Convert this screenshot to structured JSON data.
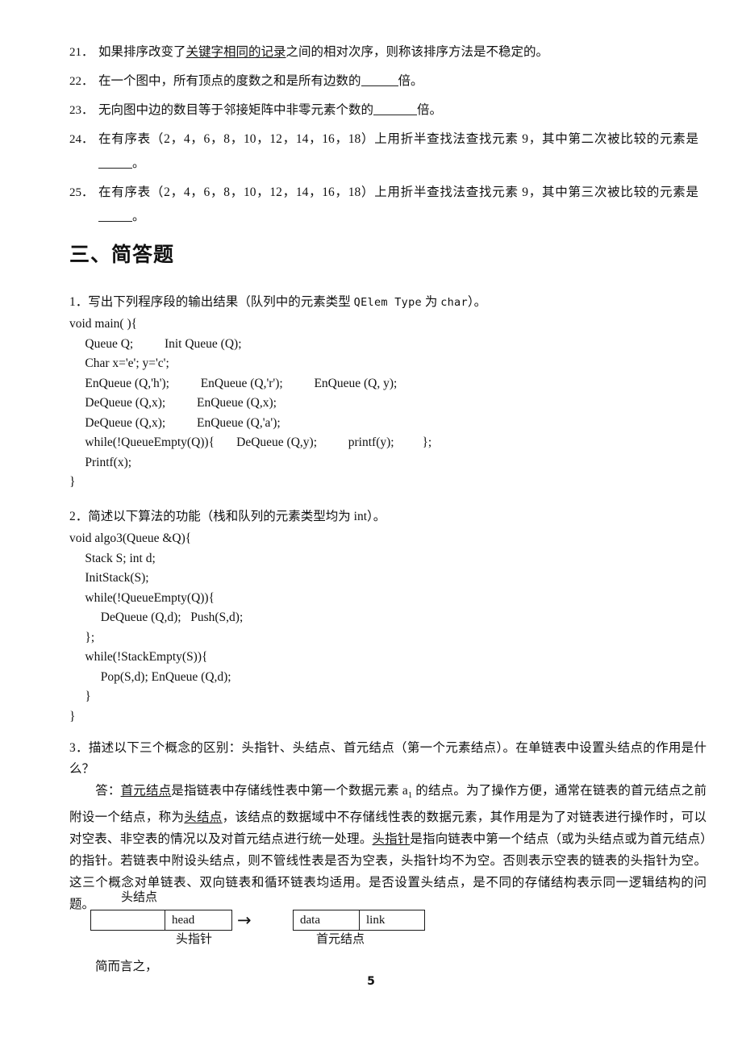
{
  "document": {
    "page_number": "5",
    "fill_in_questions": [
      {
        "number": "21．",
        "pre": "如果排序改变了",
        "underlined": "关键字相同的记录",
        "post": "之间的相对次序，则称该排序方法是不稳定的。",
        "has_blank": false
      },
      {
        "number": "22．",
        "pre": "在一个图中，所有顶点的度数之和是所有边数的",
        "underlined": "",
        "post": "倍。",
        "has_blank": true
      },
      {
        "number": "23．",
        "pre": "无向图中边的数目等于邻接矩阵中非零元素个数的",
        "underlined": "",
        "post": "倍。",
        "has_blank": true
      },
      {
        "number": "24．",
        "pre": "在有序表（2，4，6，8，10，12，14，16，18）上用折半查找法查找元素 9，其中第二次被比较的元素是",
        "underlined": "",
        "post": "。",
        "has_blank": true
      },
      {
        "number": "25．",
        "pre": "在有序表（2，4，6，8，10，12，14，16，18）上用折半查找法查找元素 9，其中第三次被比较的元素是",
        "underlined": "",
        "post": "。",
        "has_blank": true
      }
    ],
    "section_heading": "三、简答题",
    "short_answers": [
      {
        "number": "1．",
        "prompt_a": "写出下列程序段的输出结果（队列中的元素类型 ",
        "prompt_mono": "QElem Type",
        "prompt_b": " 为 ",
        "prompt_mono2": "char",
        "prompt_c": "）。",
        "code": "void main( ){\n     Queue Q;          Init Queue (Q);\n     Char x='e'; y='c';\n     EnQueue (Q,'h');          EnQueue (Q,'r');          EnQueue (Q, y);\n     DeQueue (Q,x);          EnQueue (Q,x);\n     DeQueue (Q,x);          EnQueue (Q,'a');\n     while(!QueueEmpty(Q)){       DeQueue (Q,y);          printf(y);         };\n     Printf(x);\n}"
      },
      {
        "number": "2．",
        "prompt_a": "简述以下算法的功能（栈和队列的元素类型均为 int）。",
        "code": "void algo3(Queue &Q){\n     Stack S; int d;\n     InitStack(S);\n     while(!QueueEmpty(Q)){\n          DeQueue (Q,d);   Push(S,d);\n     };\n     while(!StackEmpty(S)){\n          Pop(S,d); EnQueue (Q,d);\n     }\n}"
      }
    ],
    "question3": {
      "number": "3．",
      "prompt": "描述以下三个概念的区别：头指针、头结点、首元结点（第一个元素结点）。在单链表中设置头结点的作用是什么？",
      "answer_label": "答：",
      "answer_seg1_underline": "首元结点",
      "answer_seg2": "是指链表中存储线性表中第一个数据元素 a",
      "answer_sub": "1",
      "answer_seg3": " 的结点。为了操作方便，通常在链表的首元结点之前附设一个结点，称为",
      "answer_seg4_underline": "头结点",
      "answer_seg5": "，该结点的数据域中不存储线性表的数据元素，其作用是为了对链表进行操作时，可以对空表、非空表的情况以及对首元结点进行统一处理。",
      "answer_seg6_underline": "头指针",
      "answer_seg7": "是指向链表中第一个结点（或为头结点或为首元结点）的指针。若链表中附设头结点，则不管线性表是否为空表，头指针均不为空。否则表示空表的链表的头指针为空。这三个概念对单链表、双向链表和循环链表均适用。是否设置头结点，是不同的存储结构表示同一逻辑结构的问题。"
    },
    "diagram": {
      "label_head_node": "头结点",
      "label_head_pointer": "头指针",
      "label_first_node": "首元结点",
      "head_cell_left": "",
      "head_cell_right": "head",
      "node_cell_data": "data",
      "node_cell_link": "link",
      "arrow_glyph": "→"
    },
    "tail_text": "简而言之，"
  }
}
